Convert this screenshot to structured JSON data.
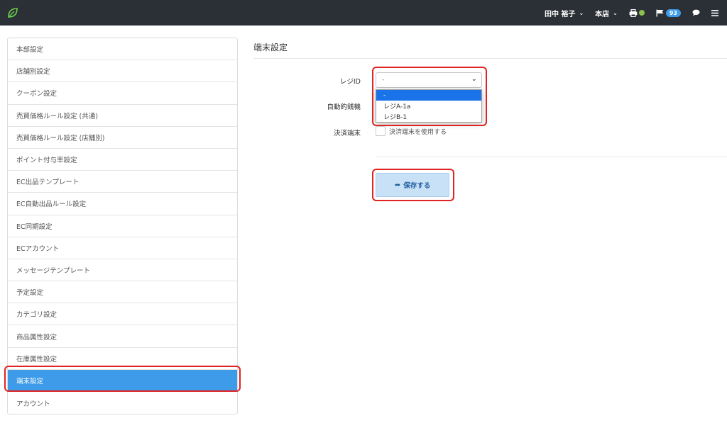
{
  "navbar": {
    "user_name": "田中 裕子",
    "store_name": "本店",
    "caret_icon": "chevron-down-icon",
    "printer_icon": "printer-icon",
    "printer_status_color": "#8bc34a",
    "flag_icon": "flag-icon",
    "notification_count": "93",
    "chat_icon": "chat-icon",
    "menu_icon": "hamburger-menu-icon"
  },
  "sidebar": {
    "items": [
      {
        "label": "本部設定"
      },
      {
        "label": "店舗別設定"
      },
      {
        "label": "クーポン設定"
      },
      {
        "label": "売買価格ルール設定 (共通)"
      },
      {
        "label": "売買価格ルール設定 (店舗別)"
      },
      {
        "label": "ポイント付与率設定"
      },
      {
        "label": "EC出品テンプレート"
      },
      {
        "label": "EC自動出品ルール設定"
      },
      {
        "label": "EC同期設定"
      },
      {
        "label": "ECアカウント"
      },
      {
        "label": "メッセージテンプレート"
      },
      {
        "label": "予定設定"
      },
      {
        "label": "カテゴリ設定"
      },
      {
        "label": "商品属性設定"
      },
      {
        "label": "在庫属性設定"
      },
      {
        "label": "端末設定"
      },
      {
        "label": "アカウント"
      }
    ],
    "active_index": 15
  },
  "main": {
    "title": "端末設定",
    "register_label": "レジID",
    "register_value": "-",
    "register_options": [
      "-",
      "レジA-1a",
      "レジB-1"
    ],
    "change_machine_label": "自動釣銭機",
    "payment_terminal_label": "決済端末",
    "payment_terminal_checkbox_label": "決済端末を使用する",
    "save_label": "保存する"
  },
  "colors": {
    "navbar_bg": "#2b3036",
    "accent": "#3d9be9",
    "highlight": "#e02424",
    "save_button_bg": "#c8e1f6"
  }
}
